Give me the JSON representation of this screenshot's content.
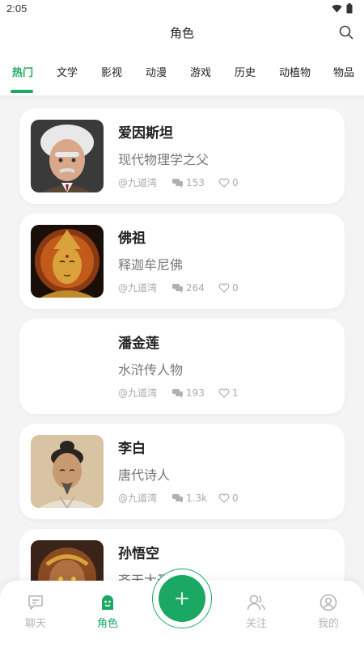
{
  "status_bar": {
    "time": "2:05"
  },
  "header": {
    "title": "角色",
    "search_icon": "search-icon"
  },
  "tabs": [
    {
      "label": "热门",
      "active": true
    },
    {
      "label": "文学"
    },
    {
      "label": "影视"
    },
    {
      "label": "动漫"
    },
    {
      "label": "游戏"
    },
    {
      "label": "历史"
    },
    {
      "label": "动植物"
    },
    {
      "label": "物品"
    }
  ],
  "cards": [
    {
      "name": "爱因斯坦",
      "desc": "现代物理学之父",
      "author": "@九道湾",
      "chats": "153",
      "likes": "0"
    },
    {
      "name": "佛祖",
      "desc": "释迦牟尼佛",
      "author": "@九道湾",
      "chats": "264",
      "likes": "0"
    },
    {
      "name": "潘金莲",
      "desc": "水浒传人物",
      "author": "@九道湾",
      "chats": "193",
      "likes": "1"
    },
    {
      "name": "李白",
      "desc": "唐代诗人",
      "author": "@九道湾",
      "chats": "1.3k",
      "likes": "0"
    },
    {
      "name": "孙悟空",
      "desc": "齐天大圣"
    }
  ],
  "bottom_nav": [
    {
      "label": "聊天",
      "icon": "chat-icon"
    },
    {
      "label": "角色",
      "icon": "character-icon",
      "active": true
    },
    {
      "label": "关注",
      "icon": "follow-icon"
    },
    {
      "label": "我的",
      "icon": "profile-icon"
    }
  ],
  "fab": {
    "icon": "plus-icon"
  },
  "colors": {
    "accent": "#1aa862",
    "meta": "#aaaaaa",
    "inactive": "#b5b5b5"
  }
}
